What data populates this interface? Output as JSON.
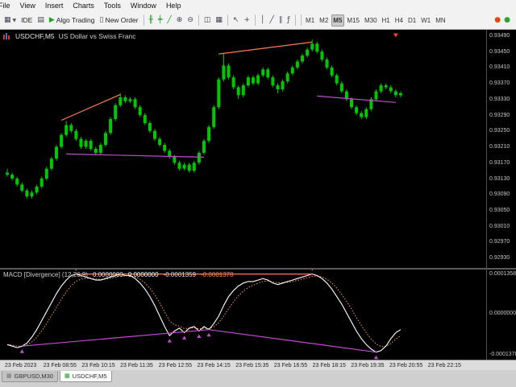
{
  "menu": {
    "items": [
      "File",
      "View",
      "Insert",
      "Charts",
      "Tools",
      "Window",
      "Help"
    ]
  },
  "toolbar": {
    "buttons": [
      {
        "name": "new-chart-button",
        "icon": "new-chart-icon",
        "glyph": "▦",
        "caret": "▼"
      },
      {
        "name": "metaeditor-button",
        "label": "IDE"
      },
      {
        "name": "profiles-button",
        "icon": "profiles-icon",
        "glyph": "▤"
      },
      {
        "name": "algo-trading-button",
        "icon": "algo-play-icon",
        "glyph": "▶",
        "glyph_color": "#1fa51f",
        "label": "Algo Trading"
      },
      {
        "name": "new-order-button",
        "icon": "order-document-icon",
        "glyph": "▯",
        "label": "New Order"
      },
      {
        "sep": true
      },
      {
        "name": "bars-chart-button",
        "icon": "bars-chart-icon",
        "glyph": "╫",
        "glyph_color": "#169416"
      },
      {
        "name": "candles-chart-button",
        "icon": "candles-chart-icon",
        "glyph": "╪",
        "glyph_color": "#169416"
      },
      {
        "name": "line-chart-button",
        "icon": "line-chart-icon",
        "glyph": "╱",
        "glyph_color": "#169416"
      },
      {
        "name": "zoom-in-button",
        "icon": "zoom-in-icon",
        "glyph": "⊕"
      },
      {
        "name": "zoom-out-button",
        "icon": "zoom-out-icon",
        "glyph": "⊖"
      },
      {
        "sep": true
      },
      {
        "name": "tile-windows-button",
        "icon": "tile-windows-icon",
        "glyph": "◫"
      },
      {
        "name": "arrange-windows-button",
        "icon": "arrange-windows-icon",
        "glyph": "▦"
      },
      {
        "sep": true
      },
      {
        "name": "cursor-button",
        "icon": "cursor-icon",
        "glyph": "↖"
      },
      {
        "name": "crosshair-button",
        "icon": "crosshair-icon",
        "glyph": "+"
      },
      {
        "sep": true
      },
      {
        "name": "vertical-line-button",
        "icon": "vertical-line-icon",
        "glyph": "│"
      },
      {
        "name": "trendline-button",
        "icon": "trendline-icon",
        "glyph": "╱"
      },
      {
        "name": "channel-button",
        "icon": "channel-icon",
        "glyph": "∥"
      },
      {
        "name": "fibonacci-button",
        "icon": "fibonacci-icon",
        "glyph": "ƒ"
      },
      {
        "sep": true
      }
    ],
    "timeframes": [
      {
        "label": "M1"
      },
      {
        "label": "M2"
      },
      {
        "label": "M5",
        "active": true
      },
      {
        "label": "M15"
      },
      {
        "label": "M30"
      },
      {
        "label": "H1"
      },
      {
        "label": "H4"
      },
      {
        "label": "D1"
      },
      {
        "label": "W1"
      },
      {
        "label": "MN"
      }
    ],
    "status_icons": [
      {
        "name": "alerts-icon",
        "glyph": "●",
        "color": "#e04a10"
      },
      {
        "name": "connection-icon",
        "glyph": "●",
        "color": "#2fa52f"
      }
    ]
  },
  "chart_window": {
    "title_symbol": "USDCHF,M5",
    "title_description": "US Dollar vs Swiss Franc"
  },
  "price_scale": {
    "labels": [
      "0.93490",
      "0.93450",
      "0.93410",
      "0.93370",
      "0.93330",
      "0.93290",
      "0.93250",
      "0.93210",
      "0.93170",
      "0.93130",
      "0.93090",
      "0.93050",
      "0.93010",
      "0.92970",
      "0.92930"
    ]
  },
  "macd": {
    "label_name": "MACD [Divergence] (12,26,9)",
    "values": [
      "0.0000000",
      "0.0000000",
      "-0.0001359",
      "-0.0001378"
    ],
    "value_colors": [
      "#e2e2e2",
      "#ffffff",
      "#dddddd",
      "#ff8c50"
    ],
    "scale_labels": [
      "0.0001358",
      "0.0000000",
      "-0.0001378"
    ]
  },
  "time_axis": {
    "labels": [
      "23 Feb 2023",
      "23 Feb 08:55",
      "23 Feb 10:15",
      "23 Feb 11:35",
      "23 Feb 12:55",
      "23 Feb 14:15",
      "23 Feb 15:35",
      "23 Feb 16:55",
      "23 Feb 18:15",
      "23 Feb 19:35",
      "23 Feb 20:55",
      "23 Feb 22:15"
    ]
  },
  "tabs": [
    {
      "label": "GBPUSD,M30",
      "active": false
    },
    {
      "label": "USDCHF,M5",
      "active": true
    }
  ],
  "chart_data": {
    "type": "candlestick",
    "symbol": "USDCHF",
    "period": "M5",
    "indicator": "MACD [Divergence] (12,26,9)",
    "price": {
      "base": 0.93,
      "pip": 0.0001,
      "view": {
        "top": 0.93505,
        "bottom": 0.92905
      },
      "candles": [
        [
          14.5,
          15.5,
          13.5,
          14
        ],
        [
          14,
          14.5,
          12.5,
          13
        ],
        [
          13,
          13.5,
          11,
          11.5
        ],
        [
          11.5,
          12,
          9.5,
          10
        ],
        [
          10,
          10.5,
          8,
          8.5
        ],
        [
          8.5,
          10,
          8,
          9.5
        ],
        [
          9.5,
          11.5,
          9,
          11
        ],
        [
          11,
          13.5,
          10.5,
          13
        ],
        [
          13,
          16,
          12.5,
          15.5
        ],
        [
          15.5,
          18.5,
          15,
          18
        ],
        [
          18,
          21.5,
          17.5,
          21
        ],
        [
          21,
          24.5,
          20.5,
          24
        ],
        [
          24,
          27.5,
          23.5,
          26.5
        ],
        [
          26.5,
          27,
          24.5,
          25
        ],
        [
          25,
          25.5,
          22.5,
          23
        ],
        [
          23,
          23.5,
          20.5,
          21
        ],
        [
          21,
          23,
          20.5,
          22.5
        ],
        [
          22.5,
          23,
          20,
          20.5
        ],
        [
          20.5,
          21,
          19,
          19.5
        ],
        [
          19.5,
          22,
          19,
          21.5
        ],
        [
          21.5,
          25,
          21,
          24.5
        ],
        [
          24.5,
          28.5,
          24,
          28
        ],
        [
          28,
          32,
          27.5,
          31.5
        ],
        [
          31.5,
          34.5,
          31,
          33.5
        ],
        [
          33.5,
          34,
          32,
          32.5
        ],
        [
          32.5,
          33.5,
          32,
          33
        ],
        [
          33,
          33.5,
          30.5,
          31
        ],
        [
          31,
          31.5,
          28.5,
          29
        ],
        [
          29,
          29.5,
          26.5,
          27
        ],
        [
          27,
          27.5,
          24.5,
          25
        ],
        [
          25,
          25.5,
          22.5,
          23
        ],
        [
          23,
          23.5,
          21,
          21.5
        ],
        [
          21.5,
          22,
          19.5,
          20
        ],
        [
          20,
          20.5,
          18,
          18.5
        ],
        [
          18.5,
          19,
          16.5,
          17
        ],
        [
          17,
          17.5,
          15,
          15.5
        ],
        [
          15.5,
          17,
          15,
          16.5
        ],
        [
          16.5,
          17,
          14.5,
          15
        ],
        [
          15,
          17.5,
          14.5,
          17
        ],
        [
          17,
          20,
          16.5,
          19.5
        ],
        [
          19.5,
          23,
          19,
          22.5
        ],
        [
          22.5,
          26.5,
          22,
          26
        ],
        [
          26,
          31.5,
          25.5,
          31
        ],
        [
          31,
          38.5,
          30.5,
          38
        ],
        [
          38,
          44.5,
          37.5,
          41.5
        ],
        [
          41.5,
          42,
          38,
          38.5
        ],
        [
          38.5,
          39,
          35.5,
          36
        ],
        [
          36,
          36.5,
          33,
          34
        ],
        [
          34,
          37,
          33.5,
          36.5
        ],
        [
          36.5,
          39,
          36,
          38.5
        ],
        [
          38.5,
          39,
          36.5,
          37
        ],
        [
          37,
          39.5,
          36.5,
          39
        ],
        [
          39,
          41,
          38.5,
          40.5
        ],
        [
          40.5,
          41,
          38,
          38.5
        ],
        [
          38.5,
          39,
          36,
          36.5
        ],
        [
          36.5,
          37,
          34.5,
          35.5
        ],
        [
          35.5,
          38,
          35,
          37.5
        ],
        [
          37.5,
          40,
          37,
          39.5
        ],
        [
          39.5,
          41.5,
          39,
          41
        ],
        [
          41,
          43,
          40.5,
          42.5
        ],
        [
          42.5,
          44.5,
          42,
          44
        ],
        [
          44,
          46,
          43.5,
          45.5
        ],
        [
          45.5,
          48,
          45,
          47
        ],
        [
          47,
          47.5,
          44.5,
          45
        ],
        [
          45,
          45.5,
          42.5,
          43
        ],
        [
          43,
          43.5,
          40.5,
          41
        ],
        [
          41,
          41.5,
          38.5,
          39
        ],
        [
          39,
          39.5,
          36.5,
          37
        ],
        [
          37,
          37.5,
          34.5,
          35
        ],
        [
          35,
          35.5,
          32.5,
          33
        ],
        [
          33,
          33.5,
          30.5,
          31
        ],
        [
          31,
          31.5,
          29,
          29.5
        ],
        [
          29.5,
          30,
          28,
          28.5
        ],
        [
          28.5,
          31,
          28,
          30.5
        ],
        [
          30.5,
          33.5,
          30,
          33
        ],
        [
          33,
          35.5,
          32.5,
          35
        ],
        [
          35,
          37,
          34.5,
          36.5
        ],
        [
          36.5,
          37,
          35.5,
          36
        ],
        [
          36,
          36.5,
          34.5,
          35
        ],
        [
          35,
          35.5,
          33.5,
          34
        ],
        [
          34,
          35,
          33.5,
          34.5
        ]
      ]
    },
    "price_trendlines": [
      {
        "i1": 11,
        "p1": 0.93277,
        "i2": 23,
        "p2": 0.93342,
        "color": "orange"
      },
      {
        "i1": 43,
        "p1": 0.93444,
        "i2": 62,
        "p2": 0.93474,
        "color": "orange"
      },
      {
        "i1": 12,
        "p1": 0.93192,
        "i2": 40,
        "p2": 0.93184,
        "color": "purple"
      },
      {
        "i1": 63,
        "p1": 0.93338,
        "i2": 79,
        "p2": 0.93322,
        "color": "purple"
      }
    ],
    "sell_marker": {
      "i": 79,
      "p": 0.93496
    },
    "macd_series": {
      "unit": 1e-05,
      "view": {
        "top": 0.000145,
        "bottom": -0.000155
      },
      "values": [
        -10.5,
        -11,
        -11.5,
        -11,
        -10,
        -8,
        -5.5,
        -2.5,
        0.5,
        3.5,
        6.5,
        9,
        11,
        12.5,
        13,
        12.5,
        12,
        11.5,
        11,
        11,
        11.5,
        12,
        12.5,
        13,
        12.5,
        12.5,
        11.5,
        10,
        8,
        5.5,
        2.5,
        -1,
        -4.5,
        -7.5,
        -6,
        -5,
        -6.5,
        -5,
        -4.5,
        -6,
        -4.5,
        -5.5,
        -3.5,
        -1,
        2.5,
        5.5,
        7.5,
        9,
        10,
        10.5,
        10.5,
        11,
        11.5,
        11,
        10,
        9.5,
        10,
        10.5,
        11,
        11.5,
        12,
        12.5,
        13,
        12.5,
        11.5,
        10,
        8,
        5.5,
        3,
        0,
        -3,
        -6,
        -8.5,
        -10.5,
        -12,
        -13,
        -12.5,
        -11,
        -8.5,
        -6.5,
        -5.5
      ]
    },
    "macd_trendlines": [
      {
        "i1": 14,
        "v1": 0.00013,
        "i2": 62,
        "v2": 0.00013,
        "color": "orange"
      },
      {
        "i1": 3,
        "v1": -0.00011,
        "i2": 41,
        "v2": -5.5e-05,
        "color": "purple"
      },
      {
        "i1": 41,
        "v1": -5.5e-05,
        "i2": 75,
        "v2": -0.00013,
        "color": "purple"
      }
    ],
    "macd_arrows": [
      {
        "i": 3,
        "dir": "up"
      },
      {
        "i": 33,
        "dir": "up"
      },
      {
        "i": 36,
        "dir": "up"
      },
      {
        "i": 39,
        "dir": "up"
      },
      {
        "i": 41,
        "dir": "up"
      },
      {
        "i": 75,
        "dir": "up"
      },
      {
        "i": 14,
        "dir": "down"
      },
      {
        "i": 62,
        "dir": "down"
      }
    ],
    "colors": {
      "bull": "#00c800",
      "orange": "#ff7b54",
      "purple": "#c44bd1",
      "macd_main": "#ffffff",
      "macd_signal": "#ff9a3c",
      "arrow_up": "#c44bd1",
      "arrow_down": "#ff8040",
      "sell_marker": "#ff3b30"
    }
  }
}
